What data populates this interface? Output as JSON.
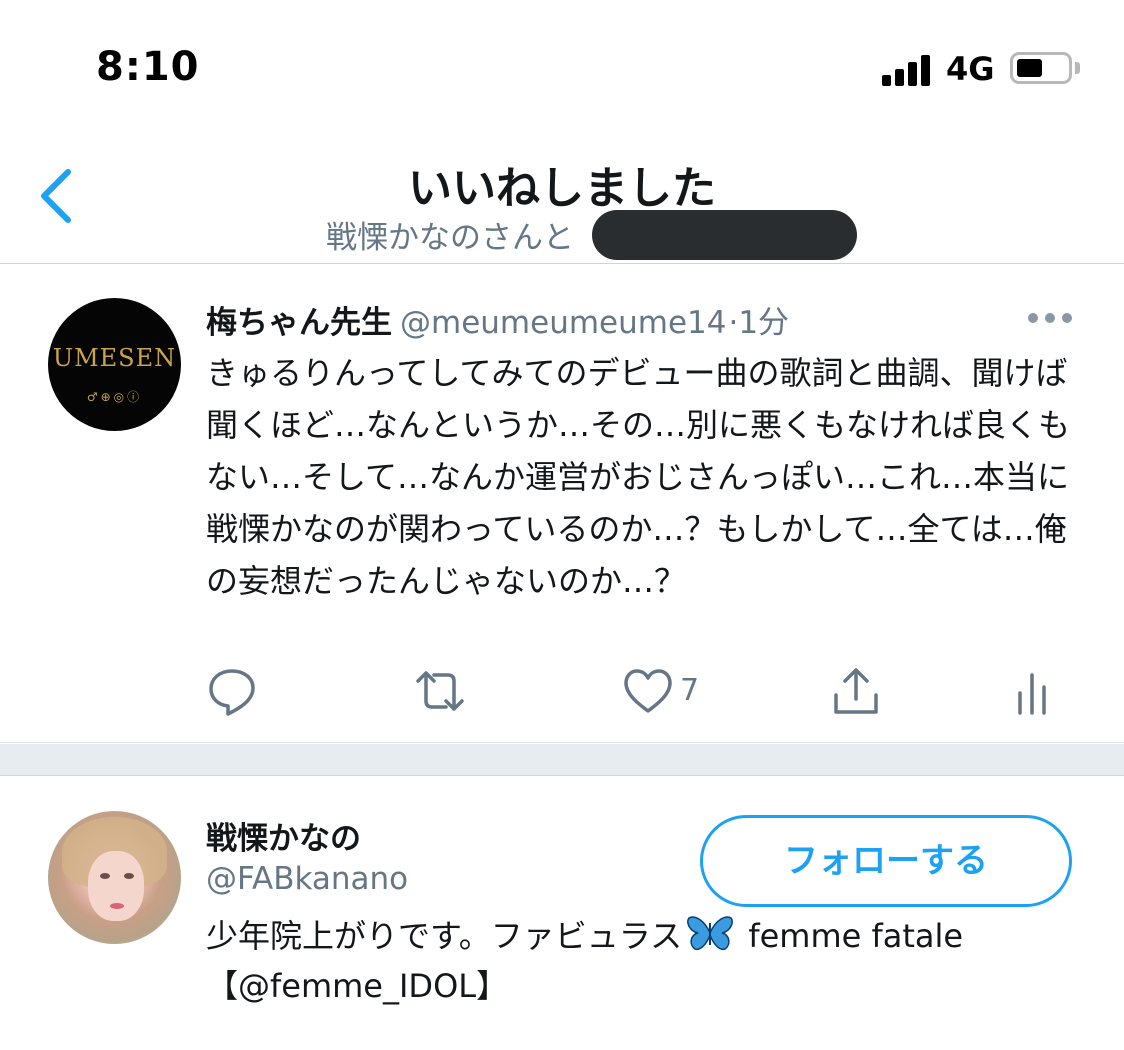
{
  "status_bar": {
    "time": "8:10",
    "network": "4G",
    "signal_icon": "signal-bars-icon",
    "battery_icon": "battery-icon",
    "battery_level": 0.5
  },
  "header": {
    "title": "いいねしました",
    "subtitle": "戦慄かなのさんと",
    "back_icon": "chevron-left-icon"
  },
  "tweet": {
    "avatar_logo": "UMESEN",
    "avatar_sub": "♂⊕◎ⓘ",
    "name": "梅ちゃん先生",
    "handle": "@meumeumeume14",
    "time": "·1分",
    "more_icon": "more-dots-icon",
    "text": "きゅるりんってしてみてのデビュー曲の歌詞と曲調、聞けば聞くほど…なんというか…その…別に悪くもなければ良くもない…そして…なんか運営がおじさんっぽい…これ…本当に戦慄かなのが関わっているのか…？もしかして…全ては…俺の妄想だったんじゃないのか…？",
    "actions": {
      "reply_icon": "reply-icon",
      "retweet_icon": "retweet-icon",
      "like_icon": "heart-icon",
      "like_count": "7",
      "share_icon": "share-icon",
      "analytics_icon": "analytics-icon"
    }
  },
  "user_card": {
    "name": "戦慄かなの",
    "handle": "@FABkanano",
    "follow_label": "フォローする",
    "bio_part1": "少年院上がりです。ファビュラス",
    "bio_emoji_icon": "butterfly-icon",
    "bio_part2": " femme fatale",
    "bio_line2": "【@femme_IDOL】"
  },
  "colors": {
    "accent": "#1da1f2",
    "secondary_text": "#657786",
    "primary_text": "#14171a",
    "separator": "#e6ecf0"
  }
}
